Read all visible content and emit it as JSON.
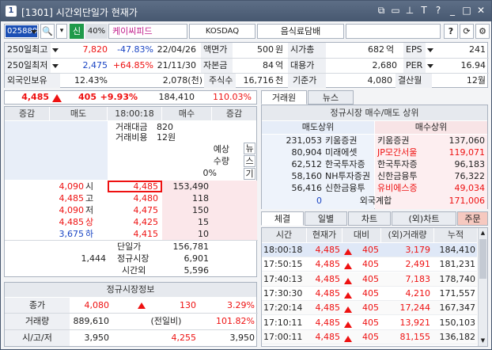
{
  "window": {
    "app_no": "1",
    "title": "[1301] 시간외단일가 현재가"
  },
  "search": {
    "code": "025880",
    "tag": "신",
    "margin": "40%",
    "name": "케이씨피드",
    "market": "KOSDAQ",
    "sector": "음식료담배"
  },
  "info": {
    "hi250_label": "250일최고",
    "hi250_val": "7,820",
    "hi250_pct": "-47.83%",
    "hi250_date": "22/04/26",
    "face_label": "액면가",
    "face_val": "500",
    "face_unit": "원",
    "mcap_label": "시가총",
    "mcap_val": "682",
    "mcap_unit": "억",
    "eps_label": "EPS",
    "eps_val": "241",
    "lo250_label": "250일최저",
    "lo250_val": "2,475",
    "lo250_pct": "+64.85%",
    "lo250_date": "21/11/30",
    "cap_label": "자본금",
    "cap_val": "84",
    "cap_unit": "억",
    "sub_label": "대용가",
    "sub_val": "2,680",
    "per_label": "PER",
    "per_val": "16.94",
    "foreign_label": "외국인보유",
    "foreign_pct": "12.43%",
    "foreign_qty": "2,078(천)",
    "shares_label": "주식수",
    "shares_val": "16,716",
    "shares_unit": "천",
    "base_label": "기준가",
    "base_val": "4,080",
    "settle_label": "결산월",
    "settle_val": "12월"
  },
  "price": {
    "current": "4,485",
    "change": "405",
    "change_pct": "+9.93%",
    "volume": "184,410",
    "ratio": "110.03%"
  },
  "orderbook": {
    "h_jeung": "증감",
    "h_sell": "매도",
    "time": "18:00:18",
    "h_buy": "매수",
    "h_jeung2": "증감",
    "trade_amt_label": "거래대금",
    "trade_amt": "820",
    "trade_cost_label": "거래비용",
    "trade_cost": "12원",
    "exp_label": "예상",
    "exp_qty_label": "수량",
    "exp_pct": "0%",
    "side_btns": [
      "뉴",
      "스",
      "기"
    ],
    "asks": [
      {
        "price": "4,485"
      },
      {
        "price": "4,480"
      },
      {
        "price": "4,475"
      },
      {
        "price": "4,425"
      },
      {
        "price": "4,415"
      }
    ],
    "bids": [
      {
        "qty": "153,490"
      },
      {
        "qty": "118"
      },
      {
        "qty": "150"
      },
      {
        "qty": "15"
      },
      {
        "qty": "10"
      }
    ],
    "marks": [
      {
        "val": "4,090",
        "lbl": "시"
      },
      {
        "val": "4,485",
        "lbl": "고"
      },
      {
        "val": "4,090",
        "lbl": "저"
      },
      {
        "val": "4,485",
        "lbl": "상"
      },
      {
        "val": "3,675",
        "lbl": "하"
      }
    ],
    "single_label": "단일가",
    "single_val": "156,781",
    "regular_label": "정규시장",
    "regular_val": "6,901",
    "after_label": "시간외",
    "after_val": "5,596",
    "ask_total": "1,444"
  },
  "regular_info": {
    "title": "정규시장정보",
    "close_label": "종가",
    "close_val": "4,080",
    "close_chg": "130",
    "close_pct": "3.29%",
    "vol_label": "거래량",
    "vol_val": "889,610",
    "prev_label": "(전일비)",
    "prev_pct": "101.82%",
    "ohl_label": "시/고/저",
    "open": "3,950",
    "high": "4,255",
    "low": "3,950"
  },
  "brokers": {
    "tab1": "거래원",
    "tab2": "뉴스",
    "title": "정규시장 매수/매도 상위",
    "sell_h": "매도상위",
    "buy_h": "매수상위",
    "rows": [
      {
        "sv": "231,053",
        "sn": "키움증권",
        "bn": "키움증권",
        "bv": "137,060"
      },
      {
        "sv": "80,904",
        "sn": "미래에셋",
        "bn": "JP모간서울",
        "bv": "119,071"
      },
      {
        "sv": "62,512",
        "sn": "한국투자증",
        "bn": "한국투자증",
        "bv": "96,183"
      },
      {
        "sv": "58,160",
        "sn": "NH투자증권",
        "bn": "신한금융투",
        "bv": "76,322"
      },
      {
        "sv": "56,416",
        "sn": "신한금융투",
        "bn": "유비에스증",
        "bv": "49,034"
      }
    ],
    "foreign_sell": "0",
    "foreign_label": "외국계합",
    "foreign_buy": "171,006"
  },
  "ticks": {
    "tabs": [
      "체결",
      "일별",
      "차트",
      "(외)차트",
      "주문"
    ],
    "h_time": "시간",
    "h_price": "현재가",
    "h_chg": "대비",
    "h_vol": "(외)거래량",
    "h_cum": "누적",
    "rows": [
      {
        "t": "18:00:18",
        "p": "4,485",
        "c": "405",
        "v": "3,179",
        "cum": "184,410"
      },
      {
        "t": "17:50:15",
        "p": "4,485",
        "c": "405",
        "v": "2,491",
        "cum": "181,231"
      },
      {
        "t": "17:40:13",
        "p": "4,485",
        "c": "405",
        "v": "7,183",
        "cum": "178,740"
      },
      {
        "t": "17:30:30",
        "p": "4,485",
        "c": "405",
        "v": "4,210",
        "cum": "171,557"
      },
      {
        "t": "17:20:14",
        "p": "4,485",
        "c": "405",
        "v": "17,244",
        "cum": "167,347"
      },
      {
        "t": "17:10:11",
        "p": "4,485",
        "c": "405",
        "v": "13,921",
        "cum": "150,103"
      },
      {
        "t": "17:00:11",
        "p": "4,485",
        "c": "405",
        "v": "81,155",
        "cum": "136,182"
      }
    ]
  }
}
